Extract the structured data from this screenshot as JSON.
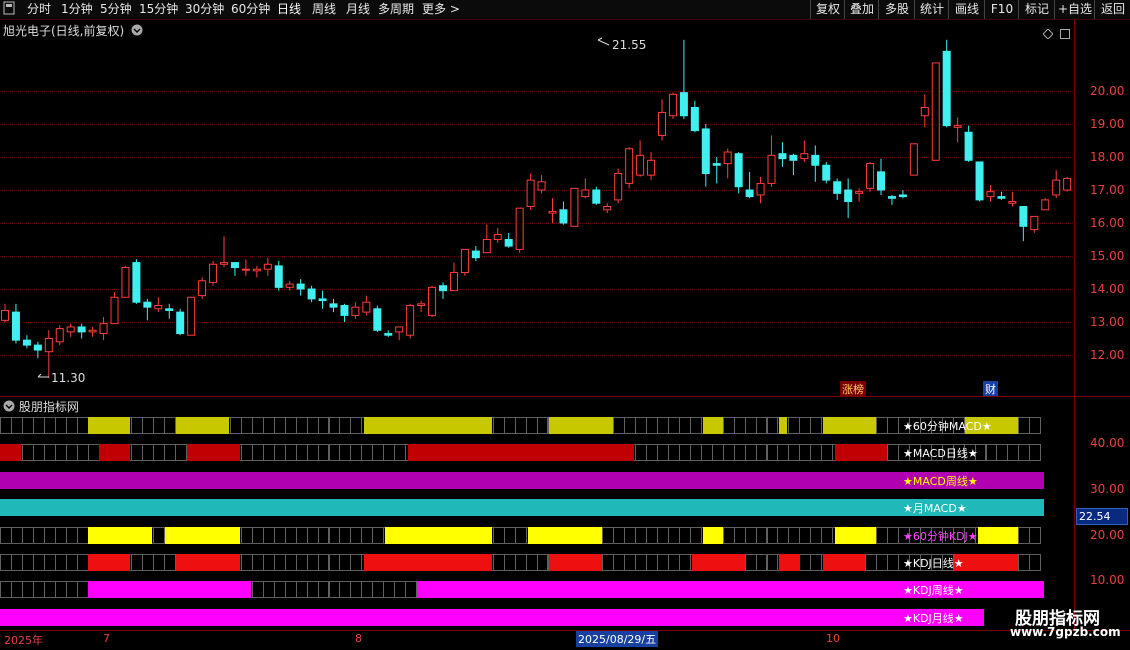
{
  "toolbar": {
    "periods": [
      "分时",
      "1分钟",
      "5分钟",
      "15分钟",
      "30分钟",
      "60分钟",
      "日线",
      "周线",
      "月线",
      "多周期",
      "更多 >"
    ],
    "right_buttons": [
      "复权",
      "叠加",
      "多股",
      "统计",
      "画线",
      "F10",
      "标记",
      "+自选",
      "返回"
    ]
  },
  "stock": {
    "title": "旭光电子(日线,前复权)",
    "menu_icon": "chevron-down-circle-icon"
  },
  "price_axis": {
    "labels": [
      "20.00",
      "19.00",
      "18.00",
      "17.00",
      "16.00",
      "15.00",
      "14.00",
      "13.00",
      "12.00"
    ]
  },
  "annotations": {
    "high": "21.55",
    "low": "11.30"
  },
  "markers": {
    "zhangbang": "涨榜",
    "cai": "财"
  },
  "indicator_panel": {
    "title": "股朋指标网",
    "axis_labels": [
      "40.00",
      "30.00",
      "20.00",
      "10.00"
    ],
    "current_value": "22.54",
    "rows": [
      {
        "label": "★60分钟MACD★",
        "label_color": "#ffffff",
        "bg": "#c8c800",
        "empty": "#000000",
        "blocks": [
          [
            88,
            130
          ],
          [
            176,
            229
          ],
          [
            364,
            492
          ],
          [
            549,
            613
          ],
          [
            703,
            723
          ],
          [
            779,
            787
          ],
          [
            823,
            876
          ],
          [
            965,
            1018
          ]
        ]
      },
      {
        "label": "★MACD日线★",
        "label_color": "#ffffff",
        "bg": "#c00000",
        "empty": "#000000",
        "blocks": [
          [
            0,
            21
          ],
          [
            99,
            130
          ],
          [
            187,
            240
          ],
          [
            408,
            634
          ],
          [
            835,
            887
          ]
        ]
      },
      {
        "label": "★MACD周线★",
        "label_color": "#ffff00",
        "bg": "#b000b0",
        "empty": "#000000",
        "blocks": [
          [
            0,
            1044
          ]
        ]
      },
      {
        "label": "★月MACD★",
        "label_color": "#ffffff",
        "bg": "#20b8b8",
        "empty": "#000000",
        "blocks": [
          [
            0,
            1044
          ]
        ]
      },
      {
        "label": "★60分钟KDJ★",
        "label_color": "#ff40ff",
        "bg": "#ffff00",
        "empty": "#000000",
        "blocks": [
          [
            88,
            152
          ],
          [
            165,
            240
          ],
          [
            385,
            492
          ],
          [
            528,
            602
          ],
          [
            703,
            723
          ],
          [
            835,
            876
          ],
          [
            978,
            1018
          ]
        ]
      },
      {
        "label": "★KDJ日线★",
        "label_color": "#ffffff",
        "bg": "#ee1010",
        "empty": "#000000",
        "blocks": [
          [
            88,
            130
          ],
          [
            176,
            240
          ],
          [
            364,
            492
          ],
          [
            549,
            602
          ],
          [
            692,
            745
          ],
          [
            779,
            800
          ],
          [
            823,
            865
          ],
          [
            954,
            1018
          ]
        ]
      },
      {
        "label": "★KDJ周线★",
        "label_color": "#ffffff",
        "bg": "#ff00ff",
        "empty": "#000000",
        "blocks": [
          [
            88,
            251
          ],
          [
            417,
            1044
          ]
        ]
      },
      {
        "label": "★KDJ月线★",
        "label_color": "#ffffff",
        "bg": "#ff00ff",
        "empty": "#000000",
        "blocks": [
          [
            0,
            984
          ]
        ]
      }
    ]
  },
  "time_axis": {
    "labels": [
      "2025年",
      "7",
      "8",
      "2025/08/29/五",
      "10"
    ],
    "highlight": "2025/08/29/五"
  },
  "watermark": {
    "text": "股朋指标网",
    "url": "www.7gpzb.com"
  },
  "colors": {
    "up": "#ff3c3c",
    "down": "#40f0f0",
    "grid": "#5a0000",
    "axis_text": "#e84040"
  },
  "candles": [
    [
      13.05,
      13.35,
      13.55,
      13.0
    ],
    [
      13.3,
      12.45,
      13.55,
      12.35
    ],
    [
      12.45,
      12.3,
      12.6,
      12.2
    ],
    [
      12.3,
      12.15,
      12.4,
      11.9
    ],
    [
      12.1,
      12.5,
      12.75,
      11.3
    ],
    [
      12.4,
      12.8,
      12.9,
      12.3
    ],
    [
      12.7,
      12.85,
      12.95,
      12.55
    ],
    [
      12.85,
      12.7,
      12.95,
      12.5
    ],
    [
      12.7,
      12.75,
      12.85,
      12.55
    ],
    [
      12.65,
      12.95,
      13.15,
      12.45
    ],
    [
      12.95,
      13.75,
      13.9,
      12.95
    ],
    [
      13.75,
      14.65,
      14.7,
      13.75
    ],
    [
      14.8,
      13.6,
      14.9,
      13.55
    ],
    [
      13.6,
      13.45,
      13.7,
      13.05
    ],
    [
      13.4,
      13.5,
      13.75,
      13.3
    ],
    [
      13.4,
      13.35,
      13.55,
      13.1
    ],
    [
      13.3,
      12.65,
      13.4,
      12.6
    ],
    [
      12.6,
      13.75,
      13.75,
      12.6
    ],
    [
      13.8,
      14.25,
      14.35,
      13.7
    ],
    [
      14.2,
      14.75,
      14.85,
      14.1
    ],
    [
      14.75,
      14.8,
      15.6,
      14.65
    ],
    [
      14.8,
      14.65,
      14.8,
      14.4
    ],
    [
      14.6,
      14.6,
      14.9,
      14.4
    ],
    [
      14.55,
      14.6,
      14.7,
      14.35
    ],
    [
      14.6,
      14.75,
      14.95,
      14.4
    ],
    [
      14.7,
      14.05,
      14.85,
      13.95
    ],
    [
      14.05,
      14.15,
      14.25,
      13.95
    ],
    [
      14.15,
      14.0,
      14.3,
      13.8
    ],
    [
      14.0,
      13.7,
      14.1,
      13.6
    ],
    [
      13.7,
      13.65,
      13.95,
      13.4
    ],
    [
      13.55,
      13.45,
      13.7,
      13.3
    ],
    [
      13.5,
      13.2,
      13.55,
      13.0
    ],
    [
      13.2,
      13.45,
      13.6,
      13.1
    ],
    [
      13.3,
      13.6,
      13.8,
      13.2
    ],
    [
      13.4,
      12.75,
      13.5,
      12.7
    ],
    [
      12.65,
      12.6,
      12.75,
      12.55
    ],
    [
      12.7,
      12.85,
      12.85,
      12.45
    ],
    [
      12.6,
      13.5,
      13.55,
      12.5
    ],
    [
      13.5,
      13.55,
      13.65,
      13.3
    ],
    [
      13.2,
      14.05,
      14.1,
      13.15
    ],
    [
      14.1,
      13.95,
      14.2,
      13.7
    ],
    [
      13.95,
      14.5,
      14.8,
      13.95
    ],
    [
      14.5,
      15.2,
      15.2,
      14.4
    ],
    [
      15.15,
      14.95,
      15.3,
      14.85
    ],
    [
      15.1,
      15.5,
      15.95,
      15.1
    ],
    [
      15.5,
      15.65,
      15.85,
      15.4
    ],
    [
      15.5,
      15.3,
      15.7,
      15.25
    ],
    [
      15.2,
      16.45,
      16.45,
      15.1
    ],
    [
      16.5,
      17.3,
      17.5,
      16.4
    ],
    [
      17.0,
      17.25,
      17.45,
      16.9
    ],
    [
      16.3,
      16.35,
      16.75,
      16.0
    ],
    [
      16.4,
      16.0,
      16.65,
      15.95
    ],
    [
      15.9,
      17.05,
      17.05,
      15.9
    ],
    [
      16.8,
      17.0,
      17.35,
      16.75
    ],
    [
      17.0,
      16.6,
      17.1,
      16.55
    ],
    [
      16.4,
      16.5,
      16.6,
      16.3
    ],
    [
      16.7,
      17.5,
      17.65,
      16.6
    ],
    [
      17.2,
      18.25,
      18.3,
      17.05
    ],
    [
      17.45,
      18.05,
      18.5,
      17.4
    ],
    [
      17.45,
      17.9,
      18.15,
      17.3
    ],
    [
      18.65,
      19.35,
      19.75,
      18.5
    ],
    [
      19.25,
      19.9,
      19.95,
      19.15
    ],
    [
      19.95,
      19.25,
      21.55,
      19.15
    ],
    [
      19.5,
      18.8,
      19.7,
      18.75
    ],
    [
      18.85,
      17.5,
      19.0,
      17.1
    ],
    [
      17.8,
      17.75,
      18.0,
      17.2
    ],
    [
      17.8,
      18.15,
      18.25,
      17.35
    ],
    [
      18.1,
      17.1,
      18.15,
      16.9
    ],
    [
      17.0,
      16.8,
      17.55,
      16.75
    ],
    [
      16.85,
      17.2,
      17.4,
      16.6
    ],
    [
      17.2,
      18.05,
      18.65,
      17.1
    ],
    [
      18.1,
      17.95,
      18.45,
      17.7
    ],
    [
      18.05,
      17.9,
      18.1,
      17.45
    ],
    [
      17.95,
      18.1,
      18.5,
      17.85
    ],
    [
      18.05,
      17.75,
      18.35,
      17.25
    ],
    [
      17.75,
      17.3,
      17.85,
      17.2
    ],
    [
      17.25,
      16.9,
      17.35,
      16.7
    ],
    [
      17.0,
      16.65,
      17.35,
      16.15
    ],
    [
      16.9,
      16.95,
      17.05,
      16.65
    ],
    [
      17.05,
      17.8,
      17.85,
      16.95
    ],
    [
      17.55,
      17.0,
      17.95,
      16.85
    ],
    [
      16.8,
      16.75,
      16.85,
      16.55
    ],
    [
      16.85,
      16.8,
      17.0,
      16.75
    ],
    [
      17.45,
      18.4,
      18.4,
      17.45
    ],
    [
      19.25,
      19.5,
      19.9,
      18.9
    ],
    [
      17.9,
      20.85,
      20.85,
      17.9
    ],
    [
      21.2,
      18.95,
      21.55,
      18.9
    ],
    [
      18.9,
      18.95,
      19.2,
      18.45
    ],
    [
      18.75,
      17.9,
      18.95,
      17.85
    ],
    [
      17.85,
      16.7,
      17.85,
      16.65
    ],
    [
      16.8,
      16.95,
      17.15,
      16.65
    ],
    [
      16.8,
      16.75,
      16.95,
      16.7
    ],
    [
      16.6,
      16.65,
      16.95,
      16.5
    ],
    [
      16.5,
      15.9,
      16.5,
      15.45
    ],
    [
      15.8,
      16.2,
      16.2,
      15.7
    ],
    [
      16.4,
      16.7,
      16.75,
      16.4
    ],
    [
      16.85,
      17.3,
      17.6,
      16.75
    ],
    [
      17.0,
      17.35,
      17.4,
      16.95
    ],
    [
      17.35,
      16.95,
      18.0,
      16.9
    ],
    [
      16.9,
      16.95,
      17.0,
      16.8
    ],
    [
      16.9,
      16.95,
      17.05,
      16.75
    ],
    [
      16.75,
      16.25,
      16.85,
      16.2
    ],
    [
      15.85,
      16.05,
      16.1,
      15.85
    ]
  ]
}
